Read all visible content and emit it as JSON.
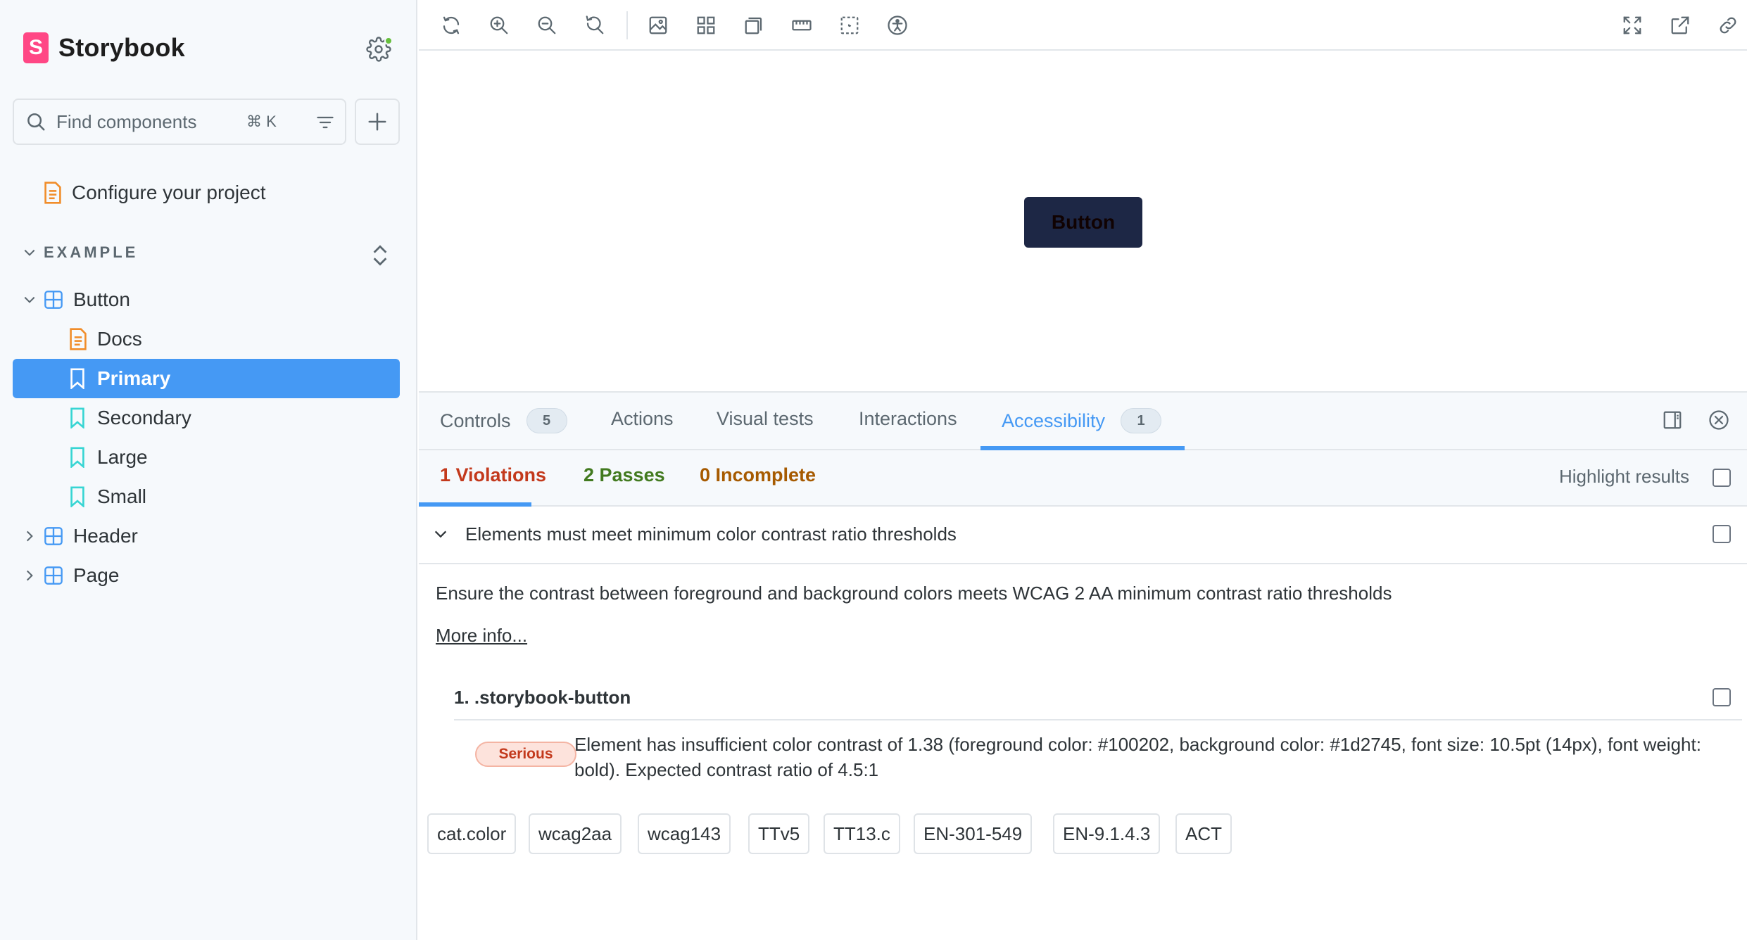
{
  "sidebar": {
    "brand": "Storybook",
    "search_placeholder": "Find components",
    "search_shortcut": "⌘ K",
    "configure_label": "Configure your project",
    "section_label": "EXAMPLE",
    "tree": [
      {
        "label": "Button",
        "type": "component",
        "expanded": true
      },
      {
        "label": "Docs",
        "type": "docs"
      },
      {
        "label": "Primary",
        "type": "story",
        "selected": true
      },
      {
        "label": "Secondary",
        "type": "story"
      },
      {
        "label": "Large",
        "type": "story"
      },
      {
        "label": "Small",
        "type": "story"
      },
      {
        "label": "Header",
        "type": "component",
        "expanded": false
      },
      {
        "label": "Page",
        "type": "component",
        "expanded": false
      }
    ]
  },
  "toolbar": {
    "icons": [
      "reload-icon",
      "zoom-in-icon",
      "zoom-out-icon",
      "zoom-reset-icon",
      "background-icon",
      "grid-icon",
      "viewport-icon",
      "measure-icon",
      "outline-icon",
      "accessibility-icon",
      "fullscreen-icon",
      "open-new-tab-icon",
      "copy-link-icon"
    ]
  },
  "canvas": {
    "button_label": "Button",
    "button_bg": "#1d2745",
    "button_fg": "#100202"
  },
  "panel": {
    "tabs": [
      {
        "label": "Controls",
        "count": "5"
      },
      {
        "label": "Actions"
      },
      {
        "label": "Visual tests"
      },
      {
        "label": "Interactions"
      },
      {
        "label": "Accessibility",
        "count": "1",
        "active": true
      }
    ],
    "subtabs": {
      "violations": "1 Violations",
      "passes": "2 Passes",
      "incomplete": "0 Incomplete",
      "highlight": "Highlight results"
    },
    "rule": {
      "title": "Elements must meet minimum color contrast ratio thresholds",
      "description": "Ensure the contrast between foreground and background colors meets WCAG 2 AA minimum contrast ratio thresholds",
      "more_info": "More info...",
      "node": "1. .storybook-button",
      "impact": "Serious",
      "message": "Element has insufficient color contrast of 1.38 (foreground color: #100202, background color: #1d2745, font size: 10.5pt (14px), font weight: bold). Expected contrast ratio of 4.5:1",
      "tags": [
        "cat.color",
        "wcag2aa",
        "wcag143",
        "TTv5",
        "TT13.c",
        "EN-301-549",
        "EN-9.1.4.3",
        "ACT"
      ]
    }
  },
  "colors": {
    "accent": "#4599f4",
    "violation": "#c3391c",
    "pass": "#427a1f",
    "incomplete": "#a65a00",
    "brand": "#ff4785"
  }
}
